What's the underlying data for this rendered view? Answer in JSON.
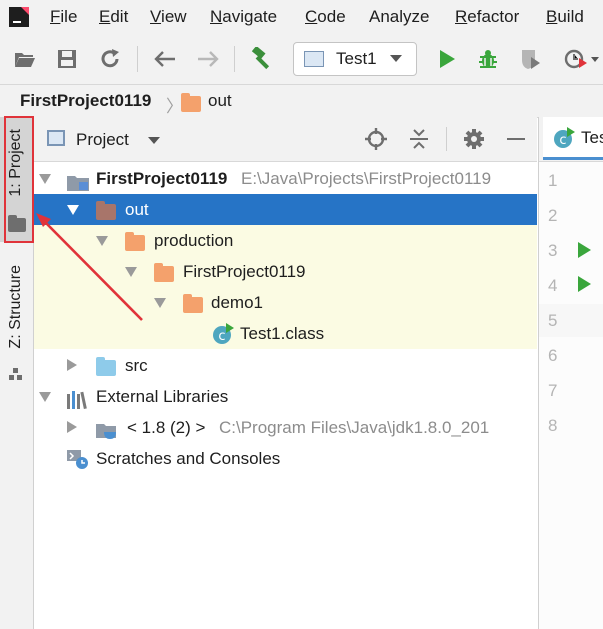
{
  "menu": {
    "items": [
      {
        "label": "File",
        "mnemonic": "F",
        "rest": "ile"
      },
      {
        "label": "Edit",
        "mnemonic": "E",
        "rest": "dit"
      },
      {
        "label": "View",
        "mnemonic": "V",
        "rest": "iew"
      },
      {
        "label": "Navigate",
        "mnemonic": "N",
        "rest": "avigate"
      },
      {
        "label": "Code",
        "mnemonic": "C",
        "rest": "ode"
      },
      {
        "label": "Analyze",
        "mnemonic": "",
        "rest": "Analyze"
      },
      {
        "label": "Refactor",
        "mnemonic": "R",
        "rest": "efactor"
      },
      {
        "label": "Build",
        "mnemonic": "B",
        "rest": "uild"
      }
    ]
  },
  "toolbar": {
    "run_config_label": "Test1"
  },
  "breadcrumb": {
    "project": "FirstProject0119",
    "folder": "out"
  },
  "left_strip": {
    "project_tab_label": "1: Project",
    "structure_tab_label": "Z: Structure"
  },
  "project_panel": {
    "title": "Project",
    "tree": {
      "root_name": "FirstProject0119",
      "root_path": "E:\\Java\\Projects\\FirstProject0119",
      "out": "out",
      "production": "production",
      "first_project": "FirstProject0119",
      "demo1": "demo1",
      "test1_class": "Test1.class",
      "src": "src",
      "external_libraries": "External Libraries",
      "jdk_label": "< 1.8 (2) >",
      "jdk_path": "C:\\Program Files\\Java\\jdk1.8.0_201",
      "scratches": "Scratches and Consoles"
    }
  },
  "editor": {
    "tab_label": "Test",
    "line_numbers": [
      "1",
      "2",
      "3",
      "4",
      "5",
      "6",
      "7",
      "8"
    ]
  },
  "colors": {
    "selection": "#2674c6",
    "highlight": "#fbfbe3",
    "excluded_folder": "#a8756a",
    "orange_folder": "#f4a16c",
    "source_folder": "#8ecbea",
    "run_green": "#3aa63c",
    "annotation_red": "#e0333a"
  }
}
